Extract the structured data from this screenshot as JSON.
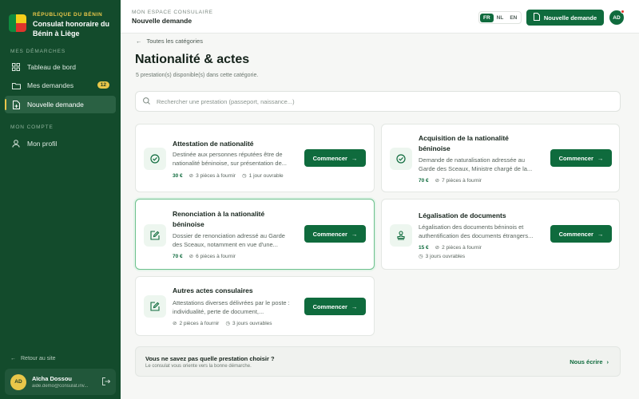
{
  "sidebar": {
    "brand_top": "RÉPUBLIQUE DU BÉNIN",
    "brand_name": "Consulat honoraire du Bénin à Liège",
    "section1": "MES DÉMARCHES",
    "section2": "MON COMPTE",
    "nav": {
      "dashboard": "Tableau de bord",
      "requests": "Mes demandes",
      "requests_badge": "12",
      "new_request": "Nouvelle demande",
      "profile": "Mon profil"
    },
    "back_to_site": "Retour au site",
    "user": {
      "initials": "AD",
      "name": "Aïcha Dossou",
      "email": "aide.demo@consulat.inv..."
    }
  },
  "topbar": {
    "supertitle": "MON ESPACE CONSULAIRE",
    "title": "Nouvelle demande",
    "langs": [
      "FR",
      "NL",
      "EN"
    ],
    "active_lang": "FR",
    "new_button": "Nouvelle demande",
    "avatar": "AD"
  },
  "main": {
    "back_link": "Toutes les catégories",
    "title": "Nationalité & actes",
    "subtitle": "5 prestation(s) disponible(s) dans cette catégorie.",
    "search_placeholder": "Rechercher une prestation (passeport, naissance...)",
    "start_label": "Commencer",
    "cards": [
      {
        "title": "Attestation de nationalité",
        "desc": "Destinée aux personnes réputées être de nationalité béninoise, sur présentation de...",
        "price": "30 €",
        "pieces": "3 pièces à fournir",
        "delay": "1 jour ouvrable",
        "icon": "check-circle-icon"
      },
      {
        "title": "Acquisition de la nationalité béninoise",
        "desc": "Demande de naturalisation adressée au Garde des Sceaux, Ministre chargé de la...",
        "price": "70 €",
        "pieces": "7 pièces à fournir",
        "delay": "",
        "icon": "check-circle-icon"
      },
      {
        "title": "Renonciation à la nationalité béninoise",
        "desc": "Dossier de renonciation adressé au Garde des Sceaux, notamment en vue d'une...",
        "price": "70 €",
        "pieces": "6 pièces à fournir",
        "delay": "",
        "icon": "edit-document-icon"
      },
      {
        "title": "Légalisation de documents",
        "desc": "Légalisation des documents béninois et authentification des documents étrangers...",
        "price": "15 €",
        "pieces": "2 pièces à fournir",
        "delay": "3 jours ouvrables",
        "icon": "stamp-icon"
      },
      {
        "title": "Autres actes consulaires",
        "desc": "Attestations diverses délivrées par le poste : individualité, perte de document,...",
        "price": "",
        "pieces": "2 pièces à fournir",
        "delay": "3 jours ouvrables",
        "icon": "edit-document-icon"
      }
    ],
    "help": {
      "question": "Vous ne savez pas quelle prestation choisir ?",
      "sub": "Le consulat vous oriente vers la bonne démarche.",
      "link": "Nous écrire"
    }
  },
  "colors": {
    "sidebar": "#134b2c",
    "accent": "#0f6b3d",
    "gold": "#e9c74a"
  }
}
